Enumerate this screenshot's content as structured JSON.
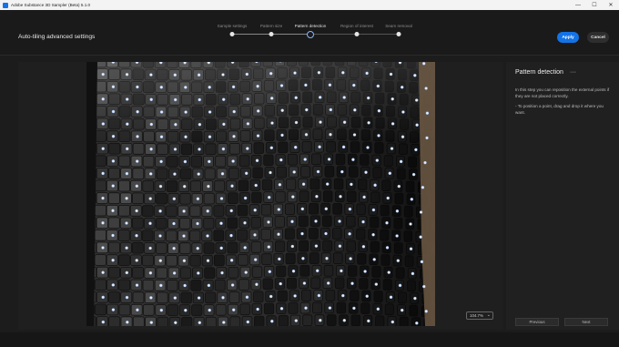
{
  "window": {
    "title": "Adobe Substance 3D Sampler (Beta) 5.1.0",
    "controls": [
      "—",
      "☐",
      "✕"
    ]
  },
  "header": {
    "title": "Auto-tiling advanced settings",
    "apply_label": "Apply",
    "cancel_label": "Cancel"
  },
  "stepper": {
    "steps": [
      {
        "label": "Sample settings",
        "state": "done"
      },
      {
        "label": "Pattern size",
        "state": "done"
      },
      {
        "label": "Pattern detection",
        "state": "active"
      },
      {
        "label": "Region of interest",
        "state": "pending"
      },
      {
        "label": "Seam removal",
        "state": "pending"
      }
    ]
  },
  "viewport": {
    "zoom": "104.7%",
    "image_description_icon": "woven-leather-texture-image"
  },
  "panel": {
    "title": "Pattern detection",
    "more_icon": "···",
    "description": "In this step you can reposition the external points if they are not placed correctly.",
    "hint": "- To position a point, drag and drop it where you want.",
    "previous_label": "Previous",
    "next_label": "Next"
  },
  "colors": {
    "accent": "#1473e6",
    "background": "#1c1c1c",
    "active_step_ring": "#8ab4f8"
  }
}
